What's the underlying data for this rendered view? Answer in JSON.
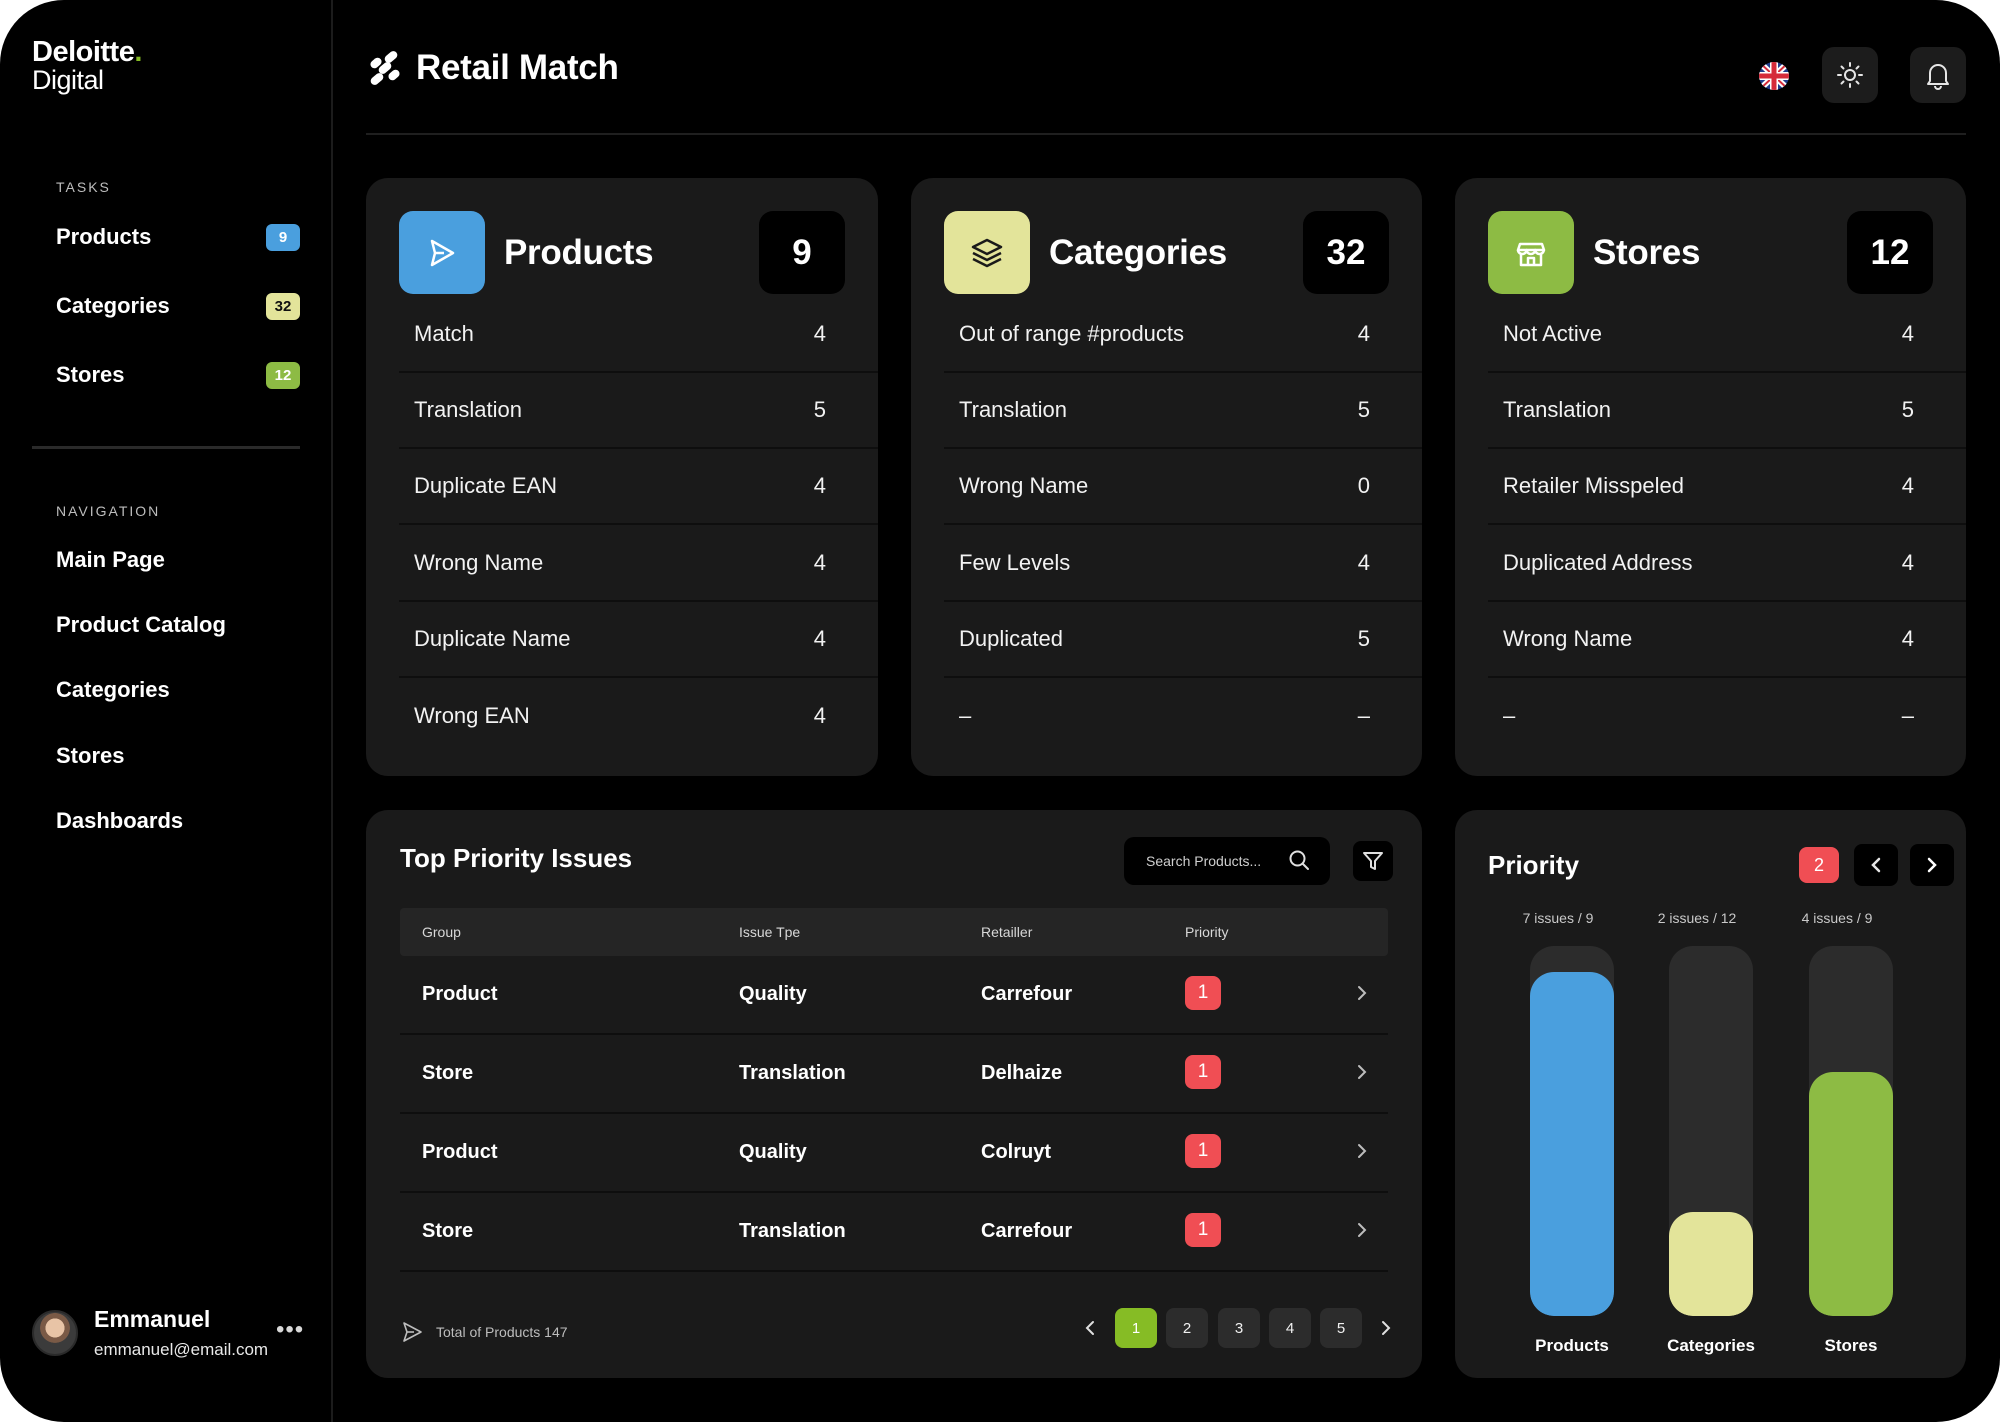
{
  "sidebar": {
    "logo_line1": "Deloitte",
    "logo_dot": ".",
    "logo_line2": "Digital",
    "tasks_label": "TASKS",
    "tasks": [
      {
        "label": "Products",
        "count": "9",
        "color": "#4a9fde"
      },
      {
        "label": "Categories",
        "count": "32",
        "color": "#e3e49a"
      },
      {
        "label": "Stores",
        "count": "12",
        "color": "#8dbb44"
      }
    ],
    "navigation_label": "NAVIGATION",
    "navigation": [
      {
        "label": "Main Page"
      },
      {
        "label": "Product Catalog"
      },
      {
        "label": "Categories"
      },
      {
        "label": "Stores"
      },
      {
        "label": "Dashboards"
      }
    ],
    "user": {
      "name": "Emmanuel",
      "email": "emmanuel@email.com",
      "more": "•••"
    }
  },
  "header": {
    "title": "Retail Match",
    "language_icon": "uk-flag-icon",
    "theme_icon": "sun-icon",
    "notification_icon": "bell-icon"
  },
  "cards": [
    {
      "title": "Products",
      "count": "9",
      "icon": "play-pointer-icon",
      "color": "#4a9fde",
      "rows": [
        {
          "label": "Match",
          "value": "4"
        },
        {
          "label": "Translation",
          "value": "5"
        },
        {
          "label": "Duplicate EAN",
          "value": "4"
        },
        {
          "label": "Wrong Name",
          "value": "4"
        },
        {
          "label": "Duplicate Name",
          "value": "4"
        },
        {
          "label": "Wrong EAN",
          "value": "4"
        }
      ]
    },
    {
      "title": "Categories",
      "count": "32",
      "icon": "layers-icon",
      "color": "#e3e49a",
      "rows": [
        {
          "label": "Out of range #products",
          "value": "4"
        },
        {
          "label": "Translation",
          "value": "5"
        },
        {
          "label": "Wrong Name",
          "value": "0"
        },
        {
          "label": "Few Levels",
          "value": "4"
        },
        {
          "label": "Duplicated",
          "value": "5"
        },
        {
          "label": "–",
          "value": "–"
        }
      ]
    },
    {
      "title": "Stores",
      "count": "12",
      "icon": "store-icon",
      "color": "#8dbb44",
      "rows": [
        {
          "label": "Not Active",
          "value": "4"
        },
        {
          "label": "Translation",
          "value": "5"
        },
        {
          "label": "Retailer Misspeled",
          "value": "4"
        },
        {
          "label": "Duplicated Address",
          "value": "4"
        },
        {
          "label": "Wrong Name",
          "value": "4"
        },
        {
          "label": "–",
          "value": "–"
        }
      ]
    }
  ],
  "issues": {
    "title": "Top Priority Issues",
    "search_placeholder": "Search Products...",
    "columns": [
      "Group",
      "Issue Tpe",
      "Retailler",
      "Priority"
    ],
    "rows": [
      {
        "group": "Product",
        "issue": "Quality",
        "retailer": "Carrefour",
        "priority": "1"
      },
      {
        "group": "Store",
        "issue": "Translation",
        "retailer": "Delhaize",
        "priority": "1"
      },
      {
        "group": "Product",
        "issue": "Quality",
        "retailer": "Colruyt",
        "priority": "1"
      },
      {
        "group": "Store",
        "issue": "Translation",
        "retailer": "Carrefour",
        "priority": "1"
      }
    ],
    "footer": "Total of Products 147",
    "pages": [
      "1",
      "2",
      "3",
      "4",
      "5"
    ],
    "active_page": "1"
  },
  "priority": {
    "title": "Priority",
    "badge": "2",
    "bars": [
      {
        "label": "Products",
        "issues": "7",
        "total": "9",
        "caption_mid": " issues / ",
        "fill_fraction": 0.93,
        "color": "#4a9fde"
      },
      {
        "label": "Categories",
        "issues": "2",
        "total": "12",
        "caption_mid": " issues / ",
        "fill_fraction": 0.28,
        "color": "#e3e49a"
      },
      {
        "label": "Stores",
        "issues": "4",
        "total": "9",
        "caption_mid": " issues / ",
        "fill_fraction": 0.66,
        "color": "#8dbb44"
      }
    ]
  }
}
